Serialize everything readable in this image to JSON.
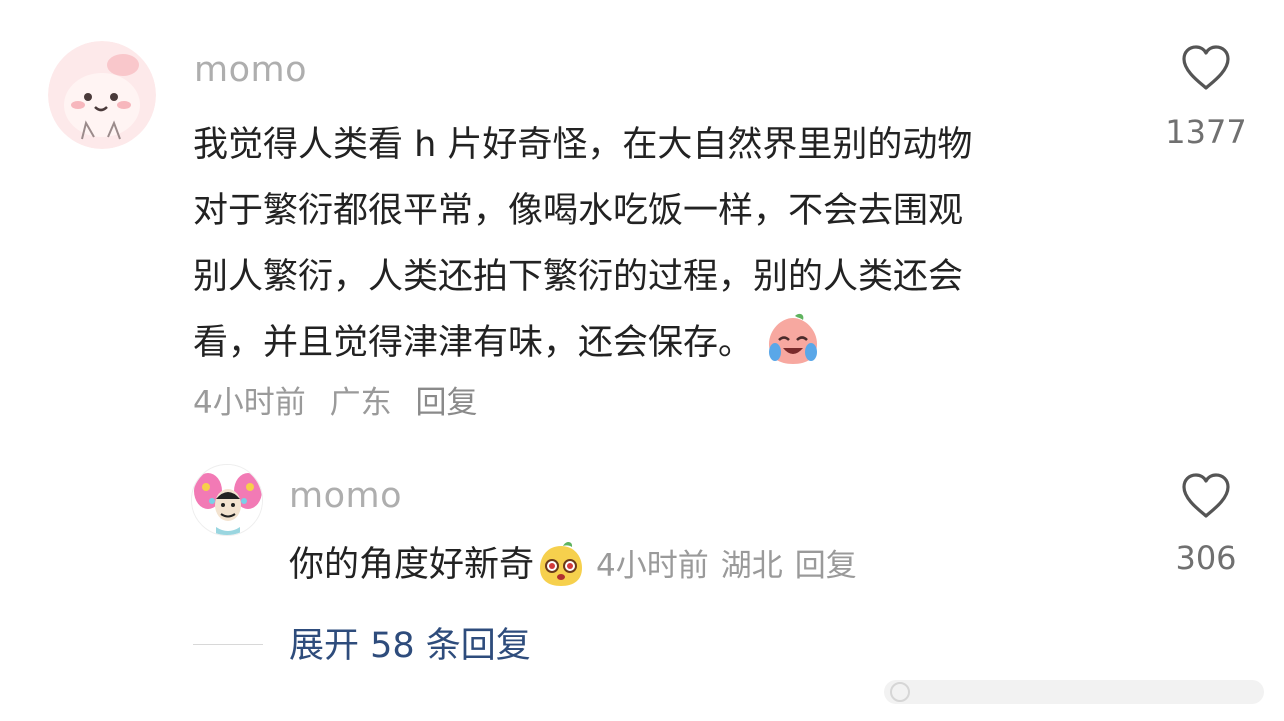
{
  "comment": {
    "username": "momo",
    "avatar_icon": "pink-creature-avatar-icon",
    "lines": [
      "我觉得人类看 h 片好奇怪，在大自然界里别的动物",
      "对于繁衍都很平常，像喝水吃饭一样，不会去围观",
      "别人繁衍，人类还拍下繁衍的过程，别的人类还会",
      "看，并且觉得津津有味，还会保存。"
    ],
    "emoji_icon": "laughing-crying-emoji-icon",
    "time": "4小时前",
    "location": "广东",
    "reply_label": "回复",
    "like_icon": "heart-outline-icon",
    "like_count": "1377"
  },
  "reply": {
    "username": "momo",
    "avatar_icon": "butterfly-face-avatar-icon",
    "text": "你的角度好新奇",
    "emoji_icon": "surprised-bean-emoji-icon",
    "time": "4小时前",
    "location": "湖北",
    "reply_label": "回复",
    "like_icon": "heart-outline-icon",
    "like_count": "306"
  },
  "expand": {
    "label": "展开 58 条回复",
    "color": "#2e4c7c"
  },
  "colors": {
    "username": "#aeaeae",
    "body": "#222222",
    "meta": "#9a9a9a"
  }
}
